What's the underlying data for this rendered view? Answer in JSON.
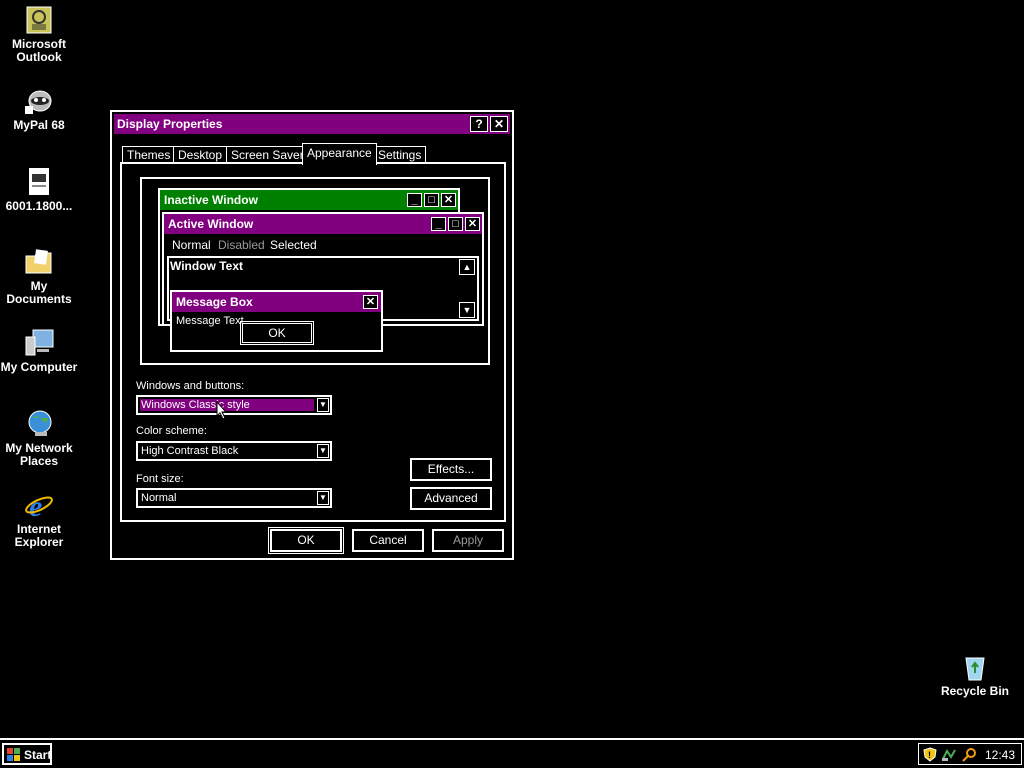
{
  "desktop": {
    "icons": [
      {
        "label": "Microsoft Outlook",
        "icon": "outlook-icon"
      },
      {
        "label": "MyPal 68",
        "icon": "mypal-icon"
      },
      {
        "label": "6001.1800...",
        "icon": "document-icon"
      },
      {
        "label": "My Documents",
        "icon": "folder-icon"
      },
      {
        "label": "My Computer",
        "icon": "computer-icon"
      },
      {
        "label": "My Network Places",
        "icon": "network-icon"
      },
      {
        "label": "Internet Explorer",
        "icon": "ie-icon"
      },
      {
        "label": "Recycle Bin",
        "icon": "recycle-bin-icon"
      }
    ]
  },
  "dialog": {
    "title": "Display Properties",
    "help_glyph": "?",
    "close_glyph": "✕",
    "tabs": [
      "Themes",
      "Desktop",
      "Screen Saver",
      "Appearance",
      "Settings"
    ],
    "active_tab": "Appearance",
    "preview": {
      "inactive_title": "Inactive Window",
      "active_title": "Active Window",
      "menu_normal": "Normal",
      "menu_disabled": "Disabled",
      "menu_selected": "Selected",
      "window_text": "Window Text",
      "msgbox_title": "Message Box",
      "msgbox_text": "Message Text",
      "msgbox_ok": "OK"
    },
    "windows_buttons_label": "Windows and buttons:",
    "windows_buttons_value": "Windows Classic style",
    "color_scheme_label": "Color scheme:",
    "color_scheme_value": "High Contrast Black",
    "font_size_label": "Font size:",
    "font_size_value": "Normal",
    "effects_label": "Effects...",
    "advanced_label": "Advanced",
    "ok_label": "OK",
    "cancel_label": "Cancel",
    "apply_label": "Apply"
  },
  "taskbar": {
    "start_label": "Start",
    "clock": "12:43"
  },
  "colors": {
    "background": "#000000",
    "active_caption": "#800080",
    "inactive_caption": "#008000",
    "text": "#ffffff"
  }
}
